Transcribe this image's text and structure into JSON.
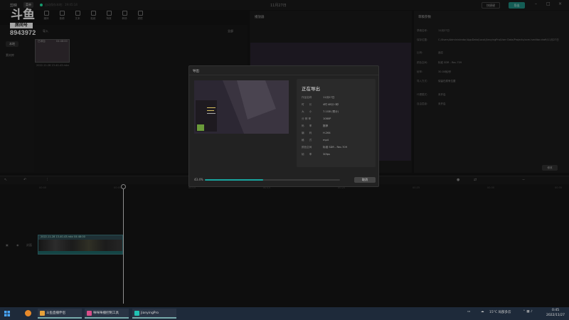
{
  "titlebar": {
    "app_name": "剪映",
    "menu_label": "菜单",
    "autosave": "自动保存本地：19:45:14",
    "doc_title": "11月27日",
    "shortcut_label": "快捷键",
    "export_label": "导出"
  },
  "watermark": {
    "logo_text": "斗鱼",
    "room_label": "房间号",
    "room_number": "8943972"
  },
  "toolbar": {
    "items": [
      {
        "label": "媒体"
      },
      {
        "label": "音频"
      },
      {
        "label": "文本"
      },
      {
        "label": "贴纸"
      },
      {
        "label": "特效"
      },
      {
        "label": "转场"
      },
      {
        "label": "滤镜"
      },
      {
        "label": "调节"
      },
      {
        "label": "素材包"
      }
    ]
  },
  "media": {
    "side_items": [
      "本地",
      "云素材",
      "素材库"
    ],
    "import_label": "导入",
    "sort_label": "全部",
    "thumb_badge": "已添加",
    "thumb_duration": "04:48:00",
    "thumb_name": "2022-11-28 13-40-43.mkv"
  },
  "player": {
    "title": "播放器"
  },
  "properties": {
    "title": "草稿参数",
    "rows": [
      {
        "label": "草稿名称：",
        "value": "11月27日"
      },
      {
        "label": "保存位置：",
        "value": "C:/Users/Administrator/AppData/Local/JianyingPro/User Data/Projects/com.lveditor.draft/11月27日"
      },
      {
        "label": "比例：",
        "value": "适应"
      },
      {
        "label": "颜色空间：",
        "value": "标准 SDR - Rec.709"
      },
      {
        "label": "帧率：",
        "value": "30.00帧/秒"
      },
      {
        "label": "导入方式：",
        "value": "保留在原有位置"
      },
      {
        "label": "代理模式：",
        "value": "未开启"
      },
      {
        "label": "自由层级：",
        "value": "未开启"
      }
    ],
    "modify_label": "修改"
  },
  "timeline": {
    "ticks": [
      "00:00",
      "00:05",
      "00:10",
      "00:15",
      "00:20",
      "00:25",
      "00:30",
      "00:35"
    ],
    "clip_label": "2022-11-28 13-40-43.mkv  04:48:00",
    "track_cover_label": "封面"
  },
  "export_dialog": {
    "title": "导出",
    "heading": "正在导出",
    "rows": [
      {
        "label": "作品名称",
        "value": "11月27日"
      },
      {
        "label": "时　　长",
        "value": "4时 48分 0秒"
      },
      {
        "label": "大　　小",
        "value": "7.1GB (预计)"
      },
      {
        "label": "分 辨 率",
        "value": "1080P"
      },
      {
        "label": "码　　率",
        "value": "推荐"
      },
      {
        "label": "编　　码",
        "value": "H.264"
      },
      {
        "label": "格　　式",
        "value": "mp4"
      },
      {
        "label": "颜色空间",
        "value": "标准 SDR - Rec.709"
      },
      {
        "label": "帧　　率",
        "value": "30fps"
      }
    ],
    "progress_text": "43.4%",
    "progress": 0.434,
    "cancel_label": "取消"
  },
  "taskbar": {
    "items": [
      {
        "label": "斗鱼直播伴侣",
        "color": "#e8a23a"
      },
      {
        "label": "咪咪咪播控制工具",
        "color": "#d94f8a"
      },
      {
        "label": "JianyingPro",
        "color": "#20c2b4"
      }
    ],
    "weather": "15°C 局部多云",
    "time": "0:45",
    "date": "2022/11/27"
  },
  "colors": {
    "accent": "#1f8f83",
    "progress": "#19a6a0"
  }
}
